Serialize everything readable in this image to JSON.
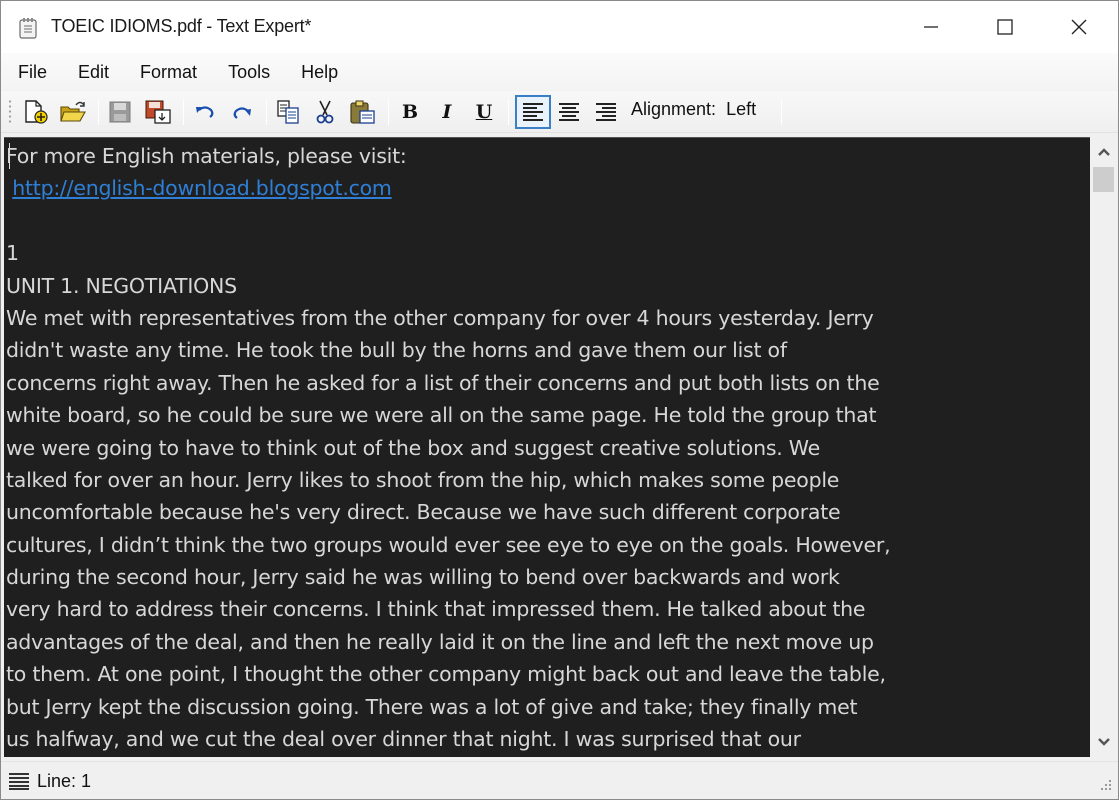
{
  "window": {
    "title": "TOEIC IDIOMS.pdf - Text Expert*",
    "app_icon": "notepad-icon",
    "controls": [
      "minimize-icon",
      "maximize-icon",
      "close-icon"
    ]
  },
  "menubar": {
    "items": [
      {
        "label": "File"
      },
      {
        "label": "Edit"
      },
      {
        "label": "Format"
      },
      {
        "label": "Tools"
      },
      {
        "label": "Help"
      }
    ]
  },
  "toolbar": {
    "buttons": [
      {
        "name": "new-file",
        "icon": "new-document-icon",
        "enabled": true
      },
      {
        "name": "open-file",
        "icon": "open-folder-icon",
        "enabled": true
      },
      {
        "name": "save",
        "icon": "save-disk-icon",
        "enabled": false
      },
      {
        "name": "save-as",
        "icon": "save-as-icon",
        "enabled": true
      },
      {
        "name": "undo",
        "icon": "undo-icon",
        "enabled": true
      },
      {
        "name": "redo",
        "icon": "redo-icon",
        "enabled": true
      },
      {
        "name": "copy",
        "icon": "copy-icon",
        "enabled": true
      },
      {
        "name": "cut",
        "icon": "scissors-icon",
        "enabled": true
      },
      {
        "name": "paste",
        "icon": "paste-clipboard-icon",
        "enabled": true
      },
      {
        "name": "bold",
        "icon": "bold-icon",
        "label": "B"
      },
      {
        "name": "italic",
        "icon": "italic-icon",
        "label": "I"
      },
      {
        "name": "underline",
        "icon": "underline-icon",
        "label": "U"
      },
      {
        "name": "align-left",
        "icon": "align-left-icon",
        "active": true
      },
      {
        "name": "align-center",
        "icon": "align-center-icon",
        "active": false
      },
      {
        "name": "align-right",
        "icon": "align-right-icon",
        "active": false
      }
    ],
    "alignment_label": "Alignment:",
    "alignment_value": "Left"
  },
  "editor": {
    "background": "#1f1f1f",
    "text_color": "#d7d7d7",
    "link_color": "#2f7fd6",
    "lines": [
      "For more English materials, please visit:",
      " http://english-download.blogspot.com",
      "",
      "1",
      "UNIT 1. NEGOTIATIONS",
      "We met with representatives from the other company for over 4 hours yesterday. Jerry",
      "didn't waste any time. He took the bull by the horns and gave them our list of",
      "concerns right away. Then he asked for a list of their concerns and put both lists on the",
      "white board, so he could be sure we were all on the same page. He told the group that",
      "we were going to have to think out of the box and suggest creative solutions. We",
      "talked for over an hour. Jerry likes to shoot from the hip, which makes some people",
      "uncomfortable because he's very direct. Because we have such different corporate",
      "cultures, I didn’t think the two groups would ever see eye to eye on the goals. However,",
      "during the second hour, Jerry said he was willing to bend over backwards and work",
      "very hard to address their concerns. I think that impressed them. He talked about the",
      "advantages of the deal, and then he really laid it on the line and left the next move up",
      "to them. At one point, I thought the other company might back out and leave the table,",
      "but Jerry kept the discussion going. There was a lot of give and take; they finally met",
      "us halfway, and we cut the deal over dinner that night. I was surprised that our"
    ],
    "link_text": "http://english-download.blogspot.com"
  },
  "statusbar": {
    "icon": "lines-icon",
    "text": "Line: 1"
  }
}
